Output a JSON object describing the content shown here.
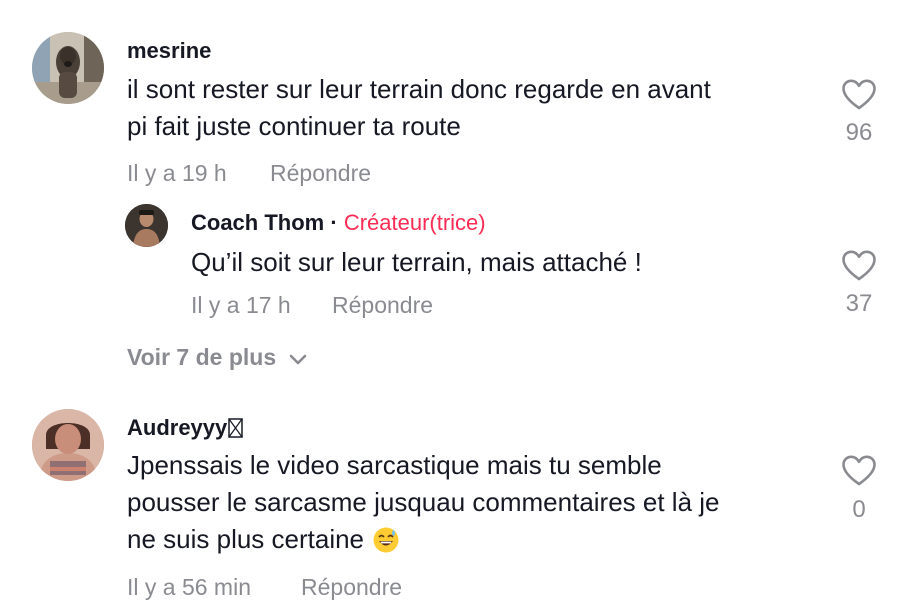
{
  "comments": [
    {
      "username": "mesrine",
      "lines": [
        "il sont rester sur leur terrain donc regarde en avant",
        "pi fait juste continuer ta route"
      ],
      "time": "Il y a 19 h",
      "reply_label": "Répondre",
      "likes": "96",
      "avatar_icon": "dog-photo-avatar",
      "reply": {
        "username": "Coach Thom",
        "separator": "·",
        "creator_label": "Créateur(trice)",
        "text": "Qu’il soit sur leur terrain, mais attaché !",
        "time": "Il y a 17 h",
        "reply_label": "Répondre",
        "likes": "37"
      },
      "more_replies": "Voir 7 de plus"
    },
    {
      "username": "Audreyyy",
      "username_suffix_icon": "missing-glyph-box",
      "lines": [
        "Jpenssais le video sarcastique mais tu semble",
        "pousser le sarcasme jusquau commentaires et là je",
        "ne suis plus certaine"
      ],
      "emoji": "grinning-sweat-emoji",
      "time": "Il y a 56 min",
      "reply_label": "Répondre",
      "likes": "0"
    }
  ],
  "colors": {
    "text": "#161823",
    "muted": "#8a8b91",
    "creator": "#fe2c55"
  }
}
